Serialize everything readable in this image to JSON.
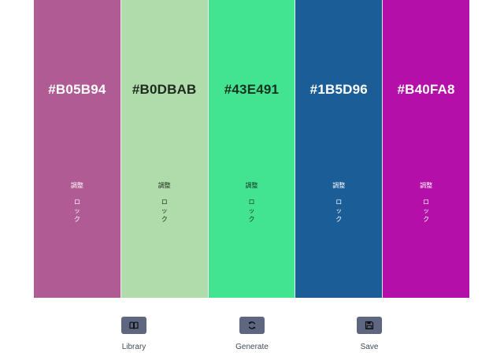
{
  "palette": {
    "swatches": [
      {
        "hex": "#B05B94",
        "color": "#B05B94",
        "text_color": "#ffffff",
        "adjust_label": "調整",
        "lock_label": "ロック"
      },
      {
        "hex": "#B0DBAB",
        "color": "#B0DBAB",
        "text_color": "#1e2a1c",
        "adjust_label": "調整",
        "lock_label": "ロック"
      },
      {
        "hex": "#43E491",
        "color": "#43E491",
        "text_color": "#17311f",
        "adjust_label": "調整",
        "lock_label": "ロック"
      },
      {
        "hex": "#1B5D96",
        "color": "#1B5D96",
        "text_color": "#ffffff",
        "adjust_label": "調整",
        "lock_label": "ロック"
      },
      {
        "hex": "#B40FA8",
        "color": "#B40FA8",
        "text_color": "#ffffff",
        "adjust_label": "調整",
        "lock_label": "ロック"
      }
    ]
  },
  "toolbar": {
    "library": {
      "label": "Library",
      "icon": "book-icon"
    },
    "generate": {
      "label": "Generate",
      "icon": "refresh-icon"
    },
    "save": {
      "label": "Save",
      "icon": "floppy-disk-icon"
    }
  },
  "colors": {
    "button_bg": "#5f6780",
    "label_text": "#444a55"
  }
}
